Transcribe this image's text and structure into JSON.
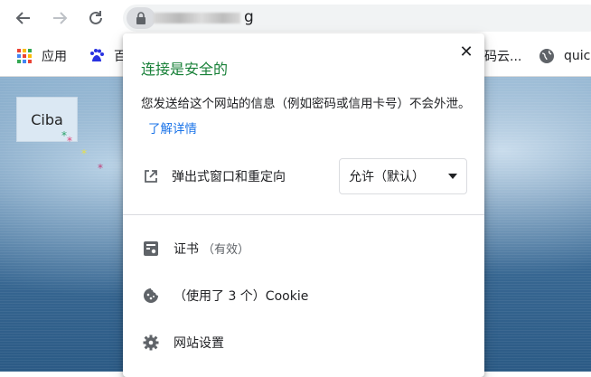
{
  "toolbar": {
    "back_icon": "arrow-left-icon",
    "forward_icon": "arrow-right-icon",
    "reload_icon": "reload-icon",
    "url_visible_tail": "g"
  },
  "bookmarks": [
    {
      "label": "应用",
      "icon": "apps-grid-icon"
    },
    {
      "label": "百",
      "icon": "baidu-paw-icon"
    },
    {
      "label": "码云...",
      "icon": ""
    },
    {
      "label": "quic",
      "icon": "globe-icon"
    }
  ],
  "page": {
    "ciba_label": "Ciba"
  },
  "popup": {
    "title": "连接是安全的",
    "description": "您发送给这个网站的信息（例如密码或信用卡号）不会外泄。",
    "learn_more": "了解详情",
    "popup_setting": {
      "label": "弹出式窗口和重定向",
      "value": "允许（默认）"
    },
    "certificate": {
      "label": "证书",
      "status": "（有效）"
    },
    "cookies": {
      "label": "（使用了 3 个）Cookie"
    },
    "site_settings": {
      "label": "网站设置"
    }
  },
  "colors": {
    "secure_green": "#188038",
    "link_blue": "#1a73e8"
  }
}
